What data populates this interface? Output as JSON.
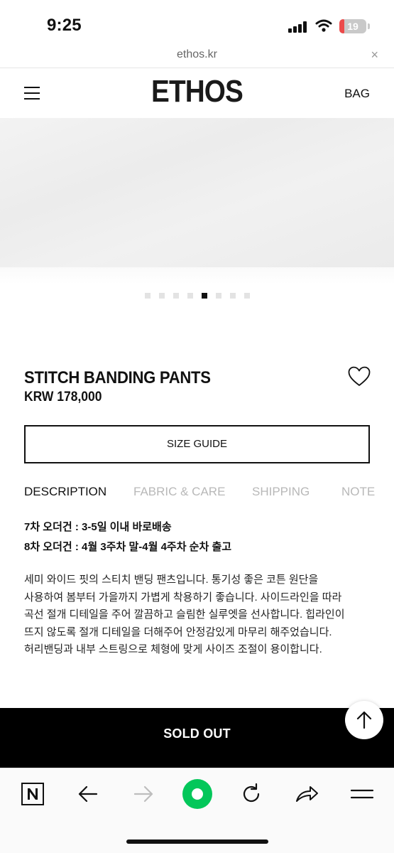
{
  "status_bar": {
    "time": "9:25",
    "battery_level": "19",
    "battery_color": "#ec4a4a"
  },
  "browser": {
    "url": "ethos.kr",
    "close_glyph": "×"
  },
  "header": {
    "logo": "ETHOS",
    "bag_label": "BAG",
    "menu_icon": "hamburger-menu-icon"
  },
  "carousel": {
    "total_slides": 8,
    "active_index": 5
  },
  "product": {
    "name": "STITCH BANDING PANTS",
    "price": "KRW 178,000",
    "size_guide_label": "SIZE GUIDE",
    "wishlist_icon": "heart-outline-icon"
  },
  "tabs": [
    {
      "label": "DESCRIPTION",
      "active": true
    },
    {
      "label": "FABRIC & CARE",
      "active": false
    },
    {
      "label": "SHIPPING",
      "active": false
    },
    {
      "label": "NOTE",
      "active": false
    }
  ],
  "order_notes": [
    "7차 오더건 : 3-5일 이내 바로배송",
    "8차 오더건 : 4월 3주차 말-4월 4주차 순차 출고"
  ],
  "description_lines": [
    "세미 와이드 핏의 스티치 밴딩 팬츠입니다. 통기성 좋은 코튼 원단을",
    "사용하여 봄부터 가을까지 가볍게 착용하기 좋습니다. 사이드라인을 따라",
    "곡선 절개 디테일을 주어 깔끔하고 슬림한 실루엣을 선사합니다. 힙라인이",
    "뜨지 않도록 절개 디테일을 더해주어 안정감있게 마무리 해주었습니다.",
    "허리밴딩과 내부 스트링으로 체형에 맞게 사이즈 조절이 용이합니다."
  ],
  "purchase": {
    "sold_out_label": "SOLD OUT",
    "scroll_top_icon": "arrow-up-icon"
  },
  "toolbar": {
    "icons": [
      "naver-logo-icon",
      "back-arrow-icon",
      "forward-arrow-icon",
      "green-home-icon",
      "reload-icon",
      "share-icon",
      "menu-lines-icon"
    ],
    "accent_color": "#03c75a"
  }
}
